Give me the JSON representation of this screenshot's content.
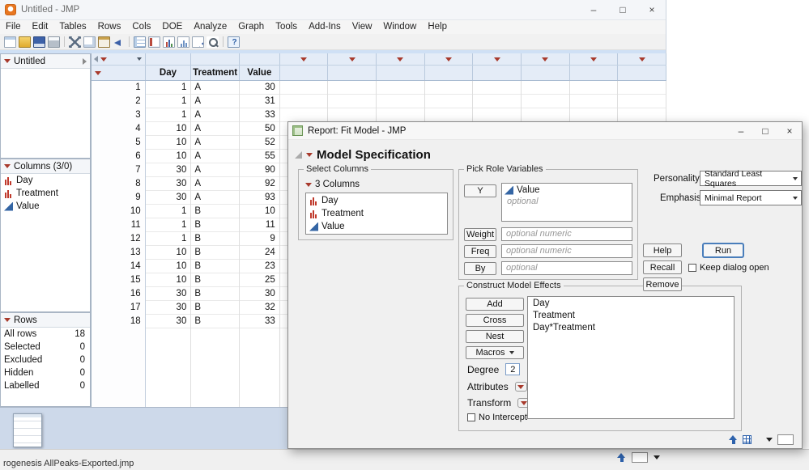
{
  "icons": {
    "minimize": "–",
    "maximize": "□",
    "close": "×"
  },
  "main_window": {
    "title": "Untitled - JMP",
    "menu": [
      "File",
      "Edit",
      "Tables",
      "Rows",
      "Cols",
      "DOE",
      "Analyze",
      "Graph",
      "Tools",
      "Add-Ins",
      "View",
      "Window",
      "Help"
    ],
    "toolbar_icons": [
      "new-icon",
      "open-icon",
      "save-icon",
      "print-icon",
      "sep",
      "cut-icon",
      "copy-icon",
      "paste-icon",
      "undo-icon",
      "sep",
      "grid-icon",
      "journal-icon",
      "chart-icon",
      "distribution-icon",
      "scatter-icon",
      "zoom-icon",
      "sep",
      "help-icon"
    ],
    "sidebar": {
      "table_panel": {
        "title": "Untitled"
      },
      "columns_panel": {
        "title": "Columns (3/0)",
        "items": [
          {
            "label": "Day",
            "type": "nominal"
          },
          {
            "label": "Treatment",
            "type": "nominal"
          },
          {
            "label": "Value",
            "type": "continuous"
          }
        ]
      },
      "rows_panel": {
        "title": "Rows",
        "stats": [
          {
            "label": "All rows",
            "value": "18"
          },
          {
            "label": "Selected",
            "value": "0"
          },
          {
            "label": "Excluded",
            "value": "0"
          },
          {
            "label": "Hidden",
            "value": "0"
          },
          {
            "label": "Labelled",
            "value": "0"
          }
        ]
      }
    },
    "table": {
      "columns": [
        "Day",
        "Treatment",
        "Value"
      ],
      "rows": [
        {
          "n": "1",
          "day": "1",
          "treatment": "A",
          "value": "30"
        },
        {
          "n": "2",
          "day": "1",
          "treatment": "A",
          "value": "31"
        },
        {
          "n": "3",
          "day": "1",
          "treatment": "A",
          "value": "33"
        },
        {
          "n": "4",
          "day": "10",
          "treatment": "A",
          "value": "50"
        },
        {
          "n": "5",
          "day": "10",
          "treatment": "A",
          "value": "52"
        },
        {
          "n": "6",
          "day": "10",
          "treatment": "A",
          "value": "55"
        },
        {
          "n": "7",
          "day": "30",
          "treatment": "A",
          "value": "90"
        },
        {
          "n": "8",
          "day": "30",
          "treatment": "A",
          "value": "92"
        },
        {
          "n": "9",
          "day": "30",
          "treatment": "A",
          "value": "93"
        },
        {
          "n": "10",
          "day": "1",
          "treatment": "B",
          "value": "10"
        },
        {
          "n": "11",
          "day": "1",
          "treatment": "B",
          "value": "11"
        },
        {
          "n": "12",
          "day": "1",
          "treatment": "B",
          "value": "9"
        },
        {
          "n": "13",
          "day": "10",
          "treatment": "B",
          "value": "24"
        },
        {
          "n": "14",
          "day": "10",
          "treatment": "B",
          "value": "23"
        },
        {
          "n": "15",
          "day": "10",
          "treatment": "B",
          "value": "25"
        },
        {
          "n": "16",
          "day": "30",
          "treatment": "B",
          "value": "30"
        },
        {
          "n": "17",
          "day": "30",
          "treatment": "B",
          "value": "32"
        },
        {
          "n": "18",
          "day": "30",
          "treatment": "B",
          "value": "33"
        }
      ]
    },
    "statusbar": {
      "text": "rogenesis  AllPeaks-Exported.jmp"
    }
  },
  "dialog": {
    "title": "Report: Fit Model - JMP",
    "header": "Model Specification",
    "select_columns": {
      "label": "Select Columns",
      "count": "3 Columns",
      "items": [
        {
          "label": "Day",
          "type": "nominal"
        },
        {
          "label": "Treatment",
          "type": "nominal"
        },
        {
          "label": "Value",
          "type": "continuous"
        }
      ]
    },
    "roles": {
      "label": "Pick Role Variables",
      "y_button": "Y",
      "y_value": "Value",
      "y_value_type": "continuous",
      "y_placeholder": "optional",
      "weight_button": "Weight",
      "weight_placeholder": "optional numeric",
      "freq_button": "Freq",
      "freq_placeholder": "optional numeric",
      "by_button": "By",
      "by_placeholder": "optional"
    },
    "effects": {
      "label": "Construct Model Effects",
      "add": "Add",
      "cross": "Cross",
      "nest": "Nest",
      "macros": "Macros",
      "degree_label": "Degree",
      "degree_value": "2",
      "attributes_label": "Attributes",
      "transform_label": "Transform",
      "no_intercept": "No Intercept",
      "items": [
        "Day",
        "Treatment",
        "Day*Treatment"
      ]
    },
    "personality_label": "Personality:",
    "personality_value": "Standard Least Squares",
    "emphasis_label": "Emphasis:",
    "emphasis_value": "Minimal Report",
    "buttons": {
      "help": "Help",
      "run": "Run",
      "recall": "Recall",
      "remove": "Remove",
      "keep_open": "Keep dialog open"
    }
  }
}
